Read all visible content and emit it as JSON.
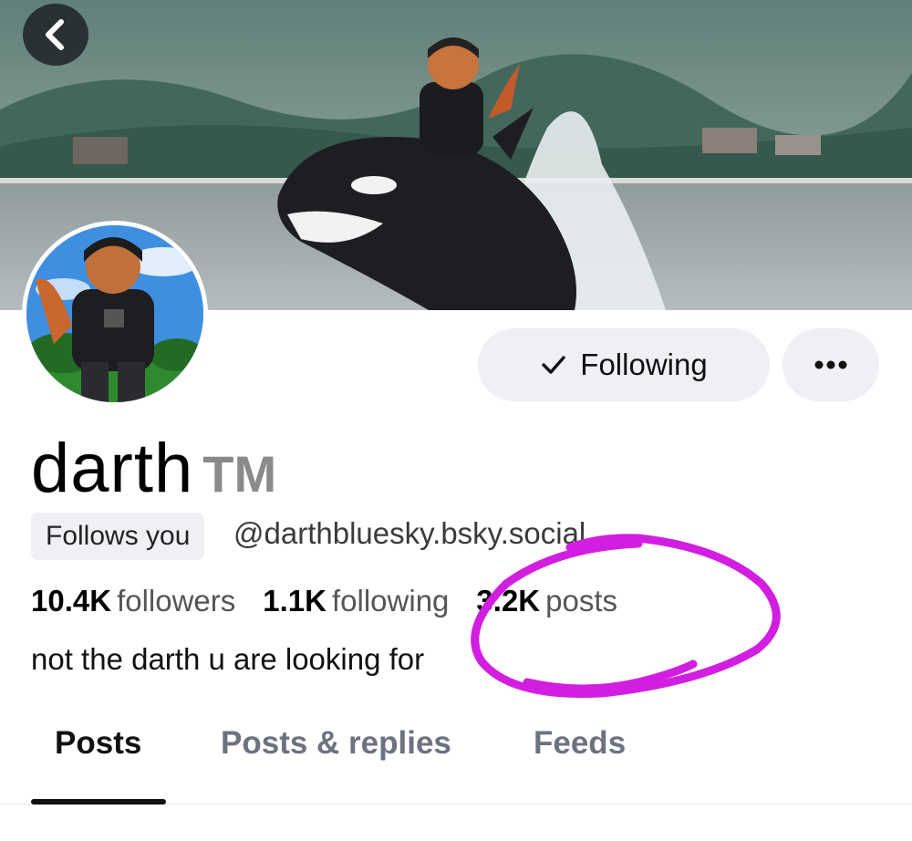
{
  "profile": {
    "display_name": "darth",
    "name_suffix": "TM",
    "follows_you_badge": "Follows you",
    "handle": "@darthbluesky.bsky.social",
    "bio": "not the darth u are looking for"
  },
  "stats": {
    "followers_count": "10.4K",
    "followers_label": "followers",
    "following_count": "1.1K",
    "following_label": "following",
    "posts_count": "3.2K",
    "posts_label": "posts"
  },
  "actions": {
    "following_label": "Following",
    "more_label": "•••"
  },
  "tabs": [
    {
      "label": "Posts",
      "active": true
    },
    {
      "label": "Posts & replies",
      "active": false
    },
    {
      "label": "Feeds",
      "active": false
    }
  ],
  "icons": {
    "back": "chevron-left-icon",
    "check": "check-icon",
    "more": "more-horizontal-icon"
  },
  "colors": {
    "annotation": "#d21ee0",
    "button_bg": "#eef0f4",
    "muted_text": "#555555"
  }
}
